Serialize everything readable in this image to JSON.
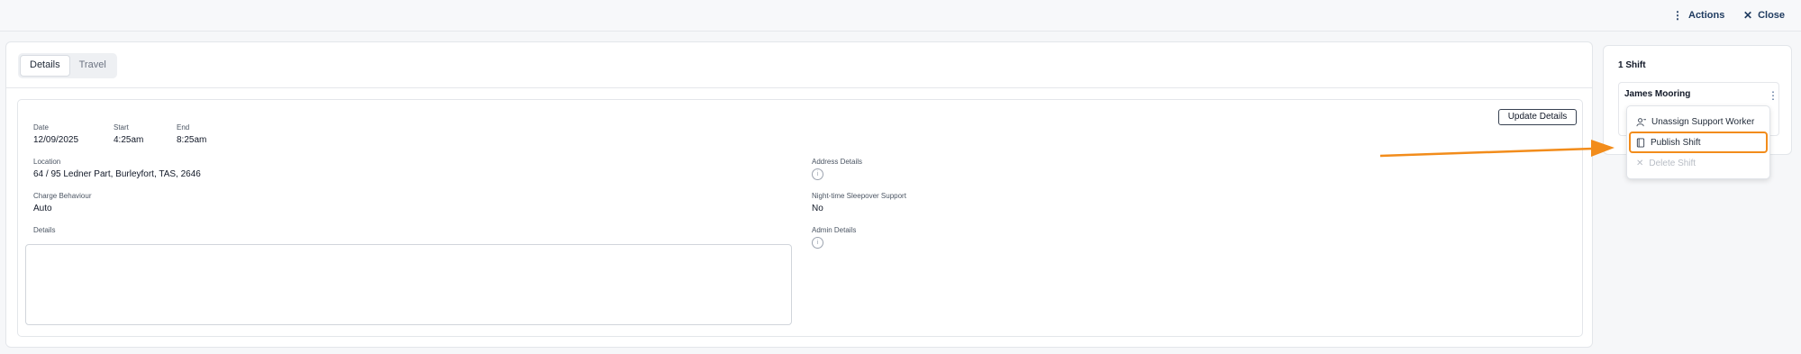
{
  "header": {
    "actions_label": "Actions",
    "close_label": "Close"
  },
  "tabs": [
    {
      "label": "Details",
      "active": true
    },
    {
      "label": "Travel",
      "active": false
    }
  ],
  "details": {
    "update_button": "Update Details",
    "date": {
      "label": "Date",
      "value": "12/09/2025"
    },
    "start": {
      "label": "Start",
      "value": "4:25am"
    },
    "end": {
      "label": "End",
      "value": "8:25am"
    },
    "location": {
      "label": "Location",
      "value": "64 / 95 Ledner Part, Burleyfort, TAS, 2646"
    },
    "address_details": {
      "label": "Address Details"
    },
    "charge_behaviour": {
      "label": "Charge Behaviour",
      "value": "Auto"
    },
    "night_sleepover": {
      "label": "Night-time Sleepover Support",
      "value": "No"
    },
    "details_field": {
      "label": "Details",
      "value": ""
    },
    "admin_details": {
      "label": "Admin Details"
    }
  },
  "shifts_panel": {
    "title": "1 Shift",
    "shift": {
      "worker_name": "James Mooring"
    }
  },
  "context_menu": {
    "items": [
      {
        "label": "Unassign Support Worker",
        "icon": "user-remove-icon",
        "disabled": false
      },
      {
        "label": "Publish Shift",
        "icon": "book-icon",
        "disabled": false,
        "highlighted": true
      },
      {
        "label": "Delete Shift",
        "icon": "close-icon",
        "disabled": true
      }
    ]
  },
  "colors": {
    "annotation_accent": "#f28c1b",
    "link_navy": "#1e3a5f"
  }
}
